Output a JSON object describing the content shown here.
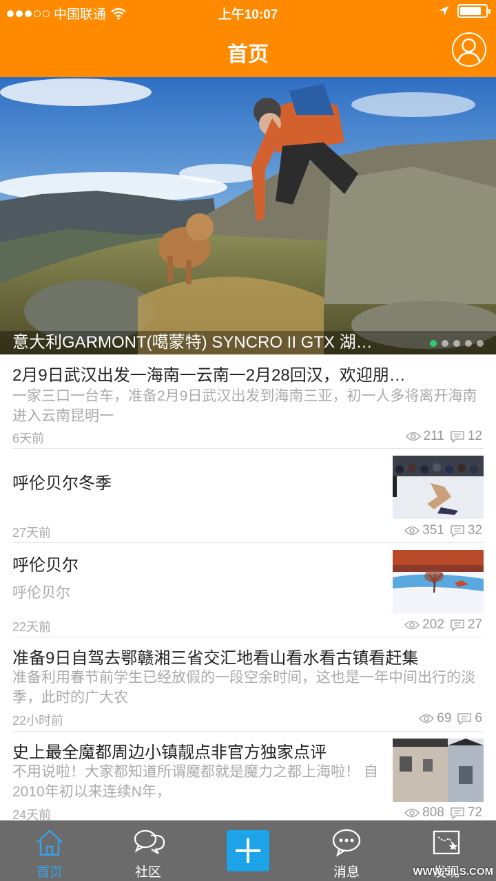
{
  "status_bar": {
    "carrier": "中国联通",
    "time": "上午10:07"
  },
  "nav": {
    "title": "首页"
  },
  "banner": {
    "caption": "意大利GARMONT(噶蒙特) SYNCRO II GTX 湖…",
    "page_count": 5,
    "active_page": 1
  },
  "feed": [
    {
      "title": "2月9日武汉出发一海南一云南一2月28回汉，欢迎朋…",
      "desc": "一家三口一台车，准备2月9日武汉出发到海南三亚，初一人多将离开海南进入云南昆明一",
      "time": "6天前",
      "views": "211",
      "comments": "12"
    },
    {
      "title": "呼伦贝尔冬季",
      "desc": "",
      "time": "27天前",
      "views": "351",
      "comments": "32"
    },
    {
      "title": "呼伦贝尔",
      "desc": "呼伦贝尔",
      "time": "22天前",
      "views": "202",
      "comments": "27"
    },
    {
      "title": "准备9日自驾去鄂赣湘三省交汇地看山看水看古镇看赶集",
      "desc": "准备利用春节前学生已经放假的一段空余时间，这也是一年中间出行的淡季，此时的广大农",
      "time": "22小时前",
      "views": "69",
      "comments": "6"
    },
    {
      "title": "史上最全魔都周边小镇靓点非官方独家点评",
      "desc": "不用说啦！大家都知道所谓魔都就是魔力之都上海啦！ 自2010年初以来连续N年，",
      "time": "24天前",
      "views": "808",
      "comments": "72"
    }
  ],
  "tabbar": {
    "home": "首页",
    "community": "社区",
    "messages": "消息",
    "discover": "发现"
  },
  "watermark": "WWW.5ILS.COM",
  "colors": {
    "header": "#ff8a00",
    "tabbar": "#6b6b6b",
    "accent": "#1da4e8",
    "active_tab": "#3aa0e6"
  }
}
